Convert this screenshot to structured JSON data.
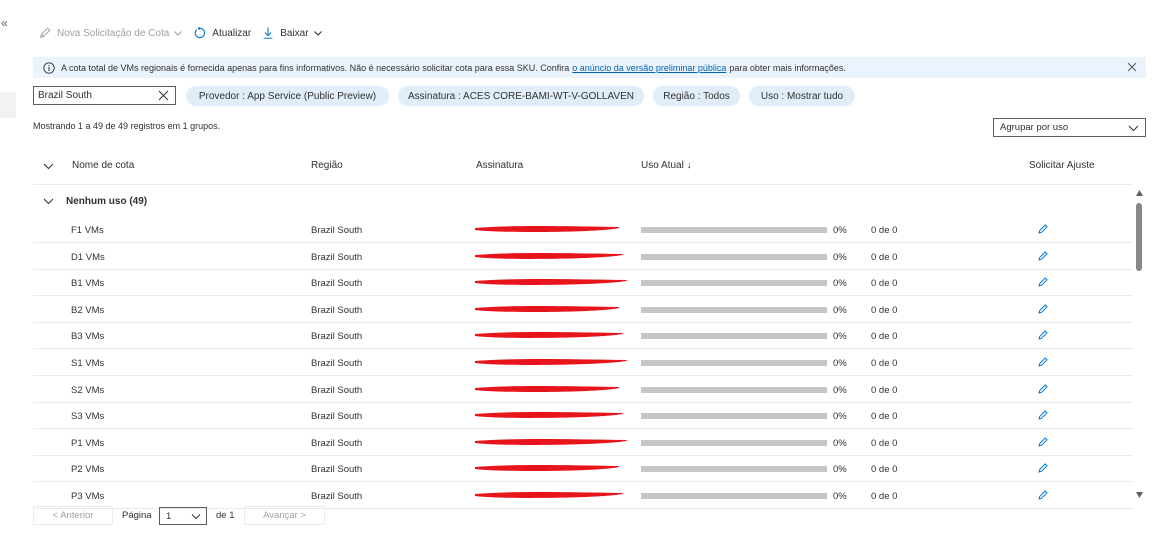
{
  "nav": {
    "collapse_glyph": "«"
  },
  "toolbar": {
    "new_request_label": "Nova Solicitação de Cota",
    "refresh_label": "Atualizar",
    "download_label": "Baixar"
  },
  "info_bar": {
    "text_before": "A cota total de VMs regionais é fornecida apenas para fins informativos. Não é necessário solicitar cota para essa SKU. Confira",
    "link_text": "o anúncio da versão preliminar pública",
    "text_after": "para obter mais informações."
  },
  "filters": {
    "search_value": "Brazil South",
    "provider": "Provedor : App Service (Public Preview)",
    "subscription": "Assinatura : ACES CORE-BAMI-WT-V-GOLLAVEN",
    "region": "Região : Todos",
    "usage": "Uso : Mostrar tudo"
  },
  "summary": {
    "records_text": "Mostrando 1 a 49 de 49 registros em 1 grupos.",
    "group_by_value": "Agrupar por uso"
  },
  "table": {
    "columns": {
      "name": "Nome de cota",
      "region": "Região",
      "subscription": "Assinatura",
      "current_usage": "Uso Atual ↓",
      "request": "Solicitar Ajuste"
    },
    "group_label": "Nenhum uso (49)",
    "rows": [
      {
        "name": "F1 VMs",
        "region": "Brazil South",
        "usage_fraction": 0,
        "percent": "0%",
        "usage": "0 de 0"
      },
      {
        "name": "D1 VMs",
        "region": "Brazil South",
        "usage_fraction": 0,
        "percent": "0%",
        "usage": "0 de 0"
      },
      {
        "name": "B1 VMs",
        "region": "Brazil South",
        "usage_fraction": 0,
        "percent": "0%",
        "usage": "0 de 0"
      },
      {
        "name": "B2 VMs",
        "region": "Brazil South",
        "usage_fraction": 0,
        "percent": "0%",
        "usage": "0 de 0"
      },
      {
        "name": "B3 VMs",
        "region": "Brazil South",
        "usage_fraction": 0,
        "percent": "0%",
        "usage": "0 de 0"
      },
      {
        "name": "S1 VMs",
        "region": "Brazil South",
        "usage_fraction": 0,
        "percent": "0%",
        "usage": "0 de 0"
      },
      {
        "name": "S2 VMs",
        "region": "Brazil South",
        "usage_fraction": 0,
        "percent": "0%",
        "usage": "0 de 0"
      },
      {
        "name": "S3 VMs",
        "region": "Brazil South",
        "usage_fraction": 0,
        "percent": "0%",
        "usage": "0 de 0"
      },
      {
        "name": "P1 VMs",
        "region": "Brazil South",
        "usage_fraction": 0,
        "percent": "0%",
        "usage": "0 de 0"
      },
      {
        "name": "P2 VMs",
        "region": "Brazil South",
        "usage_fraction": 0,
        "percent": "0%",
        "usage": "0 de 0"
      },
      {
        "name": "P3 VMs",
        "region": "Brazil South",
        "usage_fraction": 0,
        "percent": "0%",
        "usage": "0 de 0"
      }
    ]
  },
  "pagination": {
    "previous_label": "< Anterior",
    "page_label": "Página",
    "page_value": "1",
    "of_label": "de 1",
    "next_label": "Avançar >"
  },
  "colors": {
    "accent": "#0078d4",
    "info_background": "#ebf3fc",
    "pill_background": "#e1eefa",
    "redaction": "#e8141b"
  }
}
